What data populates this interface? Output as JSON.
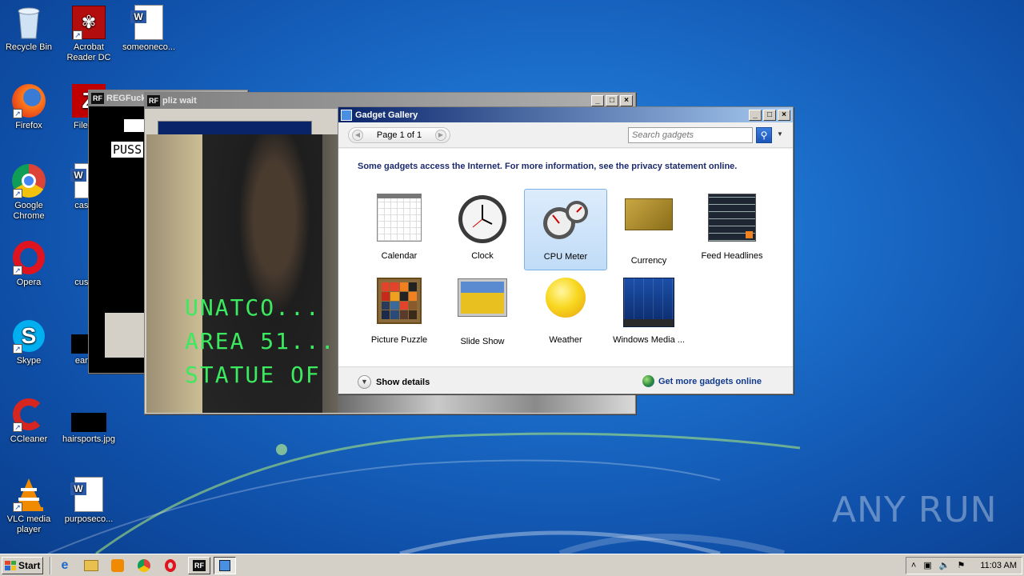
{
  "desktop": {
    "icons": [
      {
        "label": "Recycle Bin",
        "icon": "recycle-bin-icon"
      },
      {
        "label": "Acrobat Reader DC",
        "icon": "acrobat-icon"
      },
      {
        "label": "someoneco...",
        "icon": "word-document-icon"
      },
      {
        "label": "Firefox",
        "icon": "firefox-icon"
      },
      {
        "label": "FileZilla",
        "icon": "filezilla-icon"
      },
      {
        "label": "Google Chrome",
        "icon": "chrome-icon"
      },
      {
        "label": "caseab",
        "icon": "word-document-icon"
      },
      {
        "label": "Opera",
        "icon": "opera-icon"
      },
      {
        "label": "custom",
        "icon": "file-icon"
      },
      {
        "label": "Skype",
        "icon": "skype-icon"
      },
      {
        "label": "earthm",
        "icon": "image-file-icon"
      },
      {
        "label": "CCleaner",
        "icon": "ccleaner-icon"
      },
      {
        "label": "hairsports.jpg",
        "icon": "image-file-icon"
      },
      {
        "label": "VLC media player",
        "icon": "vlc-icon"
      },
      {
        "label": "purposeco...",
        "icon": "word-document-icon"
      }
    ],
    "watermark": "ANY RUN"
  },
  "regfucker_window": {
    "title": "REGFuck",
    "text_fragment": "PUSS"
  },
  "pliz_window": {
    "title": "pliz wait",
    "video_lines": [
      "UNATCO...",
      "AREA 51...",
      "STATUE OF"
    ]
  },
  "gadget_gallery": {
    "title": "Gadget Gallery",
    "page_label": "Page 1 of 1",
    "search_placeholder": "Search gadgets",
    "notice": "Some gadgets access the Internet.  For more information, see the privacy statement online.",
    "gadgets": [
      {
        "label": "Calendar",
        "icon": "calendar-icon",
        "selected": false
      },
      {
        "label": "Clock",
        "icon": "clock-icon",
        "selected": false
      },
      {
        "label": "CPU Meter",
        "icon": "cpu-meter-icon",
        "selected": true
      },
      {
        "label": "Currency",
        "icon": "currency-icon",
        "selected": false
      },
      {
        "label": "Feed Headlines",
        "icon": "feed-headlines-icon",
        "selected": false
      },
      {
        "label": "Picture Puzzle",
        "icon": "picture-puzzle-icon",
        "selected": false
      },
      {
        "label": "Slide Show",
        "icon": "slide-show-icon",
        "selected": false
      },
      {
        "label": "Weather",
        "icon": "weather-icon",
        "selected": false
      },
      {
        "label": "Windows Media ...",
        "icon": "windows-media-center-icon",
        "selected": false
      }
    ],
    "show_details": "Show details",
    "get_more": "Get more gadgets online"
  },
  "taskbar": {
    "start_label": "Start",
    "clock": "11:03 AM"
  }
}
